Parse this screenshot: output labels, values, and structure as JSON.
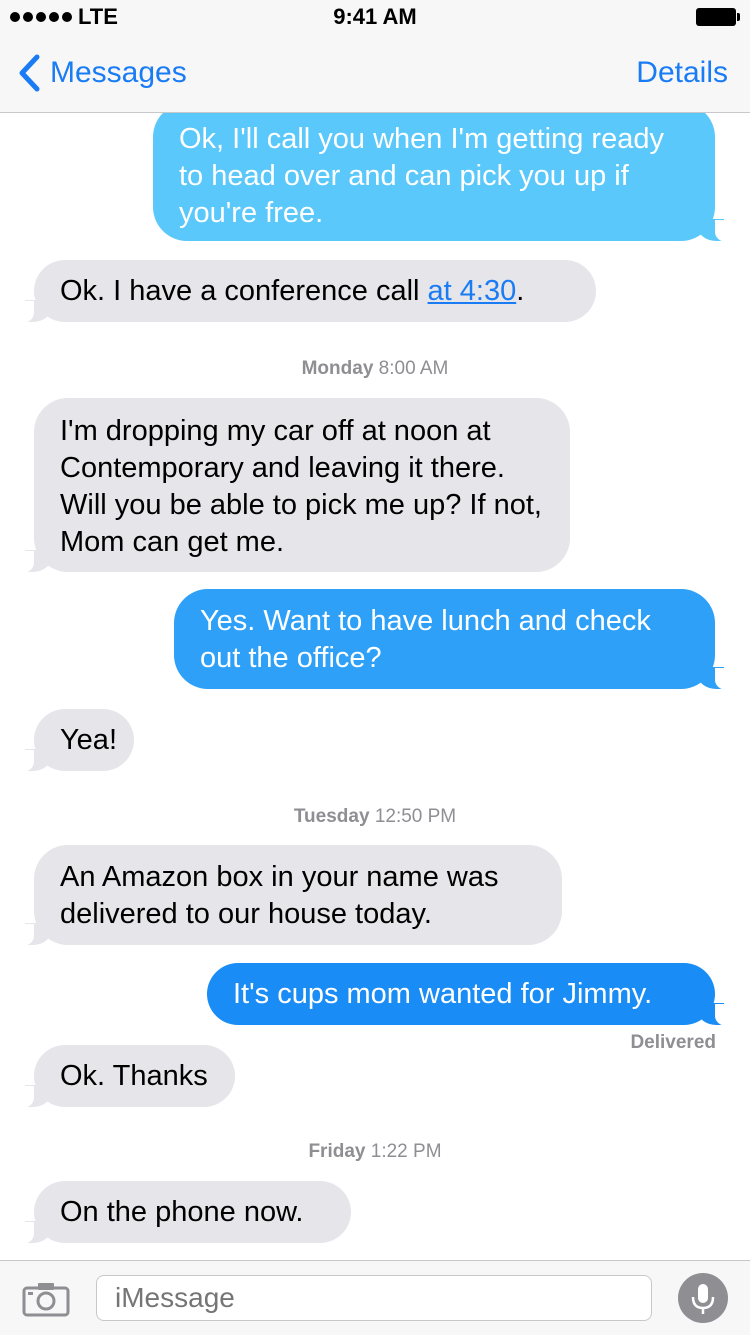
{
  "status_bar": {
    "carrier": "LTE",
    "time": "9:41 AM"
  },
  "nav": {
    "back_label": "Messages",
    "details_label": "Details"
  },
  "messages": [
    {
      "text": "Ok, I'll call you when I'm getting ready to head over and can pick you up if you're free."
    },
    {
      "text_before": "Ok. I have a conference call ",
      "link": "at 4:30",
      "text_after": "."
    },
    {
      "day": "Monday",
      "time": "8:00 AM"
    },
    {
      "text": "I'm dropping my car off at noon at Contemporary and leaving it there. Will you be able to pick me up? If not, Mom can get me."
    },
    {
      "text": "Yes. Want to have lunch and check out the office?"
    },
    {
      "text": "Yea!"
    },
    {
      "day": "Tuesday",
      "time": "12:50 PM"
    },
    {
      "text": "An Amazon box in your name was delivered to our house today."
    },
    {
      "text": "It's cups mom wanted for Jimmy."
    },
    {
      "status": "Delivered"
    },
    {
      "text": "Ok. Thanks"
    },
    {
      "day": "Friday",
      "time": "1:22 PM"
    },
    {
      "text": "On the phone now."
    }
  ],
  "input": {
    "placeholder": "iMessage"
  },
  "icons": {
    "back": "chevron-left-icon",
    "camera": "camera-icon",
    "mic": "microphone-icon"
  },
  "colors": {
    "accent": "#1a7cf5",
    "incoming_bubble": "#e5e5ea",
    "outgoing_light": "#5ac8fa",
    "outgoing_mid": "#2ea0f8",
    "outgoing_dark": "#1a8cf5"
  }
}
